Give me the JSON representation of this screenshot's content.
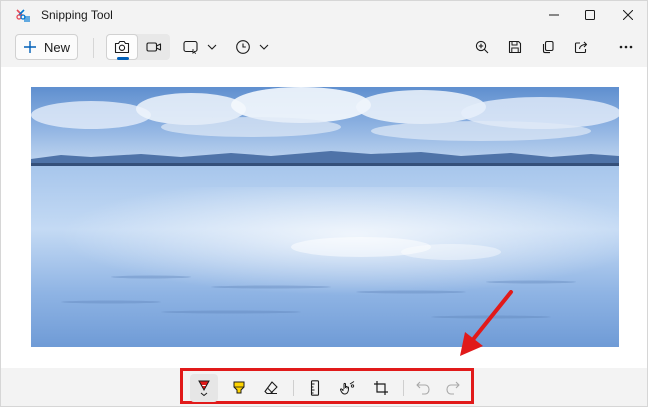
{
  "window": {
    "title": "Snipping Tool",
    "icons": [
      "app-icon",
      "minimize-icon",
      "maximize-icon",
      "close-icon"
    ]
  },
  "toolbar": {
    "new_label": "New",
    "modes": [
      "camera-icon",
      "video-icon"
    ],
    "active_mode": "camera-icon",
    "snip_shape_icon": "rectangle-snip-icon",
    "delay_icon": "clock-icon",
    "right_icons": [
      "zoom-in-icon",
      "save-icon",
      "copy-icon",
      "share-icon",
      "more-icon"
    ]
  },
  "markup_toolbar": {
    "tools": [
      "pen-icon",
      "highlighter-icon",
      "eraser-icon",
      "ruler-icon",
      "touch-writing-icon",
      "crop-icon",
      "undo-icon",
      "redo-icon"
    ],
    "active_tool": "pen-icon"
  },
  "annotation": {
    "highlight_color": "#e11a1a",
    "arrow_color": "#e11a1a"
  },
  "colors": {
    "accent": "#005fb8",
    "window_bg": "#f3f3f3"
  }
}
